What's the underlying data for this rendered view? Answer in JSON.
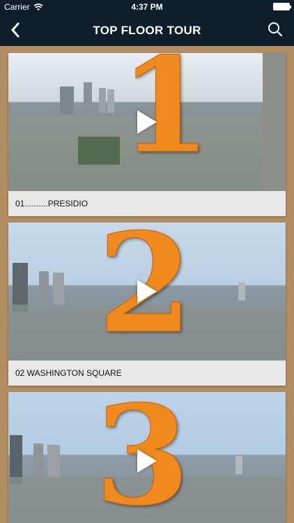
{
  "status": {
    "carrier": "Carrier",
    "time": "4:37 PM"
  },
  "nav": {
    "title": "TOP FLOOR TOUR",
    "back_icon": "chevron-left-icon",
    "search_icon": "search-icon"
  },
  "videos": [
    {
      "number": "1",
      "label": "01..........PRESIDIO"
    },
    {
      "number": "2",
      "label": "02 WASHINGTON SQUARE"
    },
    {
      "number": "3",
      "label": ""
    }
  ],
  "colors": {
    "bar": "#0f1e2d",
    "background": "#b48e63",
    "accent": "#f08a1c"
  }
}
